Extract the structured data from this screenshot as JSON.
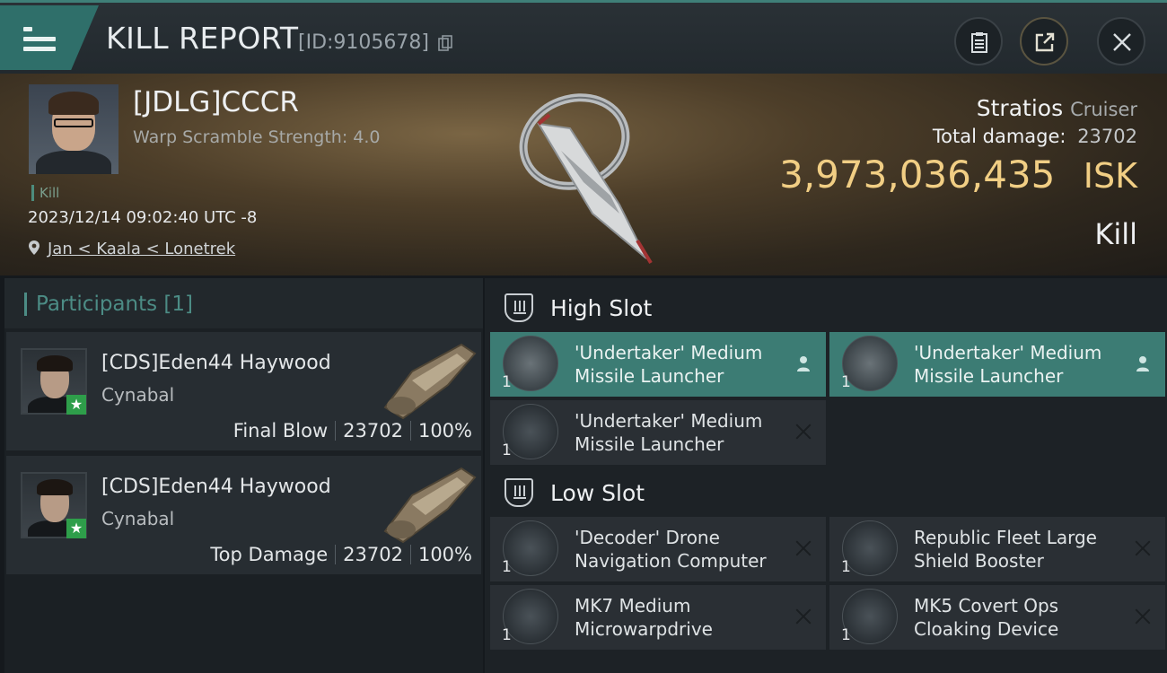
{
  "header": {
    "title": "KILL REPORT",
    "report_id": "[ID:9105678]"
  },
  "victim": {
    "name": "[JDLG]CCCR",
    "warp_scramble": "Warp Scramble Strength: 4.0",
    "tag": "Kill",
    "datetime": "2023/12/14 09:02:40 UTC -8",
    "location": "Jan < Kaala < Lonetrek"
  },
  "ship": {
    "name": "Stratios",
    "class": "Cruiser",
    "total_damage_label": "Total damage:",
    "total_damage": "23702",
    "isk_value": "3,973,036,435",
    "isk_unit": "ISK",
    "result": "Kill"
  },
  "participants": {
    "title": "Participants [1]",
    "items": [
      {
        "name": "[CDS]Eden44 Haywood",
        "ship": "Cynabal",
        "role": "Final Blow",
        "damage": "23702",
        "percent": "100%"
      },
      {
        "name": "[CDS]Eden44 Haywood",
        "ship": "Cynabal",
        "role": "Top Damage",
        "damage": "23702",
        "percent": "100%"
      }
    ]
  },
  "fittings": {
    "high_slot": {
      "label": "High Slot",
      "modules": [
        {
          "name": "'Undertaker' Medium Missile Launcher",
          "qty": "1",
          "status": "dropped"
        },
        {
          "name": "'Undertaker' Medium Missile Launcher",
          "qty": "1",
          "status": "dropped"
        },
        {
          "name": "'Undertaker' Medium Missile Launcher",
          "qty": "1",
          "status": "destroyed"
        }
      ]
    },
    "low_slot": {
      "label": "Low Slot",
      "modules": [
        {
          "name": "'Decoder' Drone Navigation Computer",
          "qty": "1",
          "status": "destroyed"
        },
        {
          "name": "Republic Fleet Large Shield Booster",
          "qty": "1",
          "status": "destroyed"
        },
        {
          "name": "MK7 Medium Microwarpdrive",
          "qty": "1",
          "status": "destroyed"
        },
        {
          "name": "MK5 Covert Ops Cloaking Device",
          "qty": "1",
          "status": "destroyed"
        }
      ]
    }
  },
  "colors": {
    "accent": "#3c7c74",
    "isk": "#f1ce84",
    "participant_star": "#2e9e4a"
  }
}
